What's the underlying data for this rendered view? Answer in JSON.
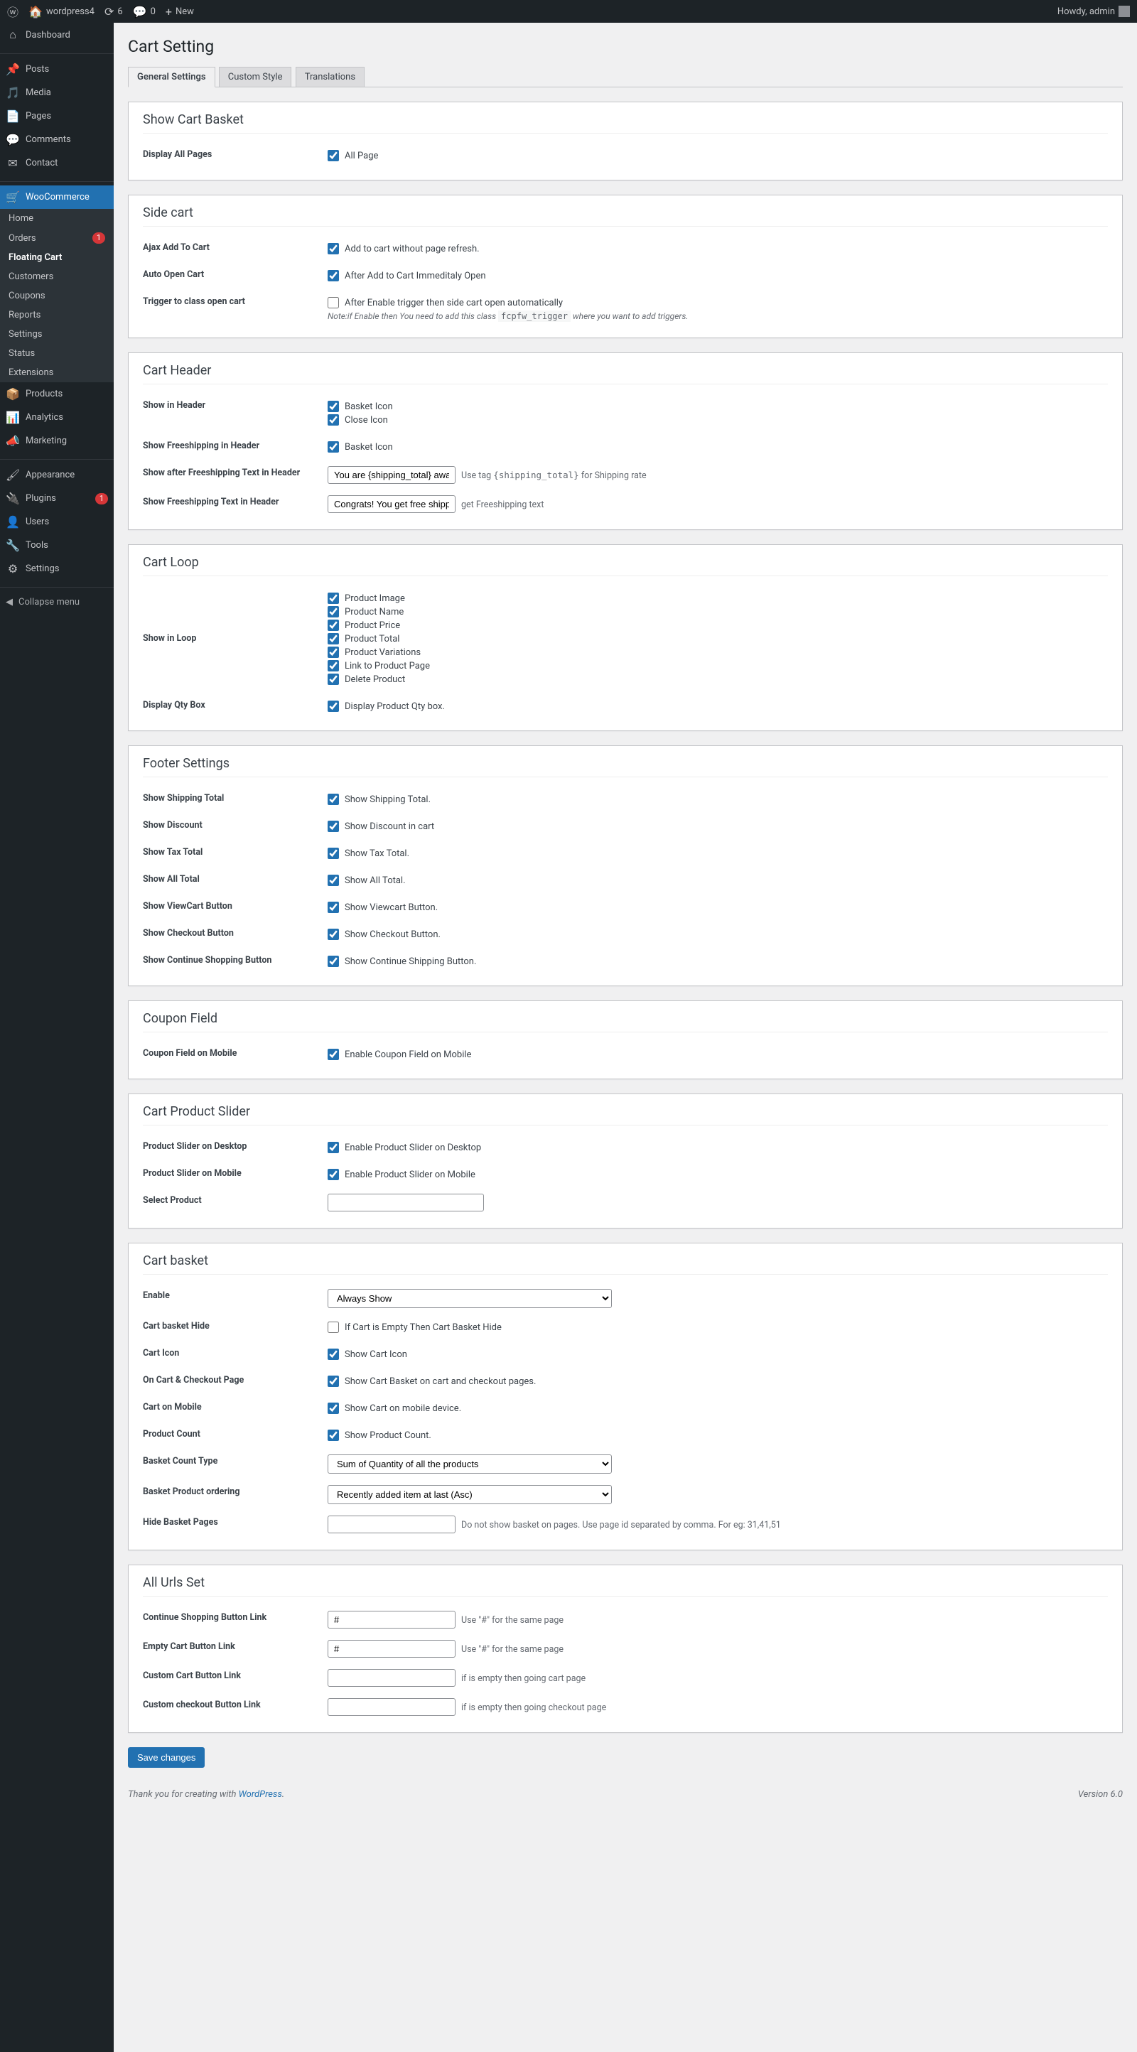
{
  "adminbar": {
    "site": "wordpress4",
    "updates": "6",
    "comments": "0",
    "new": "New",
    "howdy": "Howdy, admin"
  },
  "sidebar": {
    "dashboard": "Dashboard",
    "posts": "Posts",
    "media": "Media",
    "pages": "Pages",
    "comments": "Comments",
    "contact": "Contact",
    "woo": "WooCommerce",
    "sub_home": "Home",
    "sub_orders": "Orders",
    "orders_badge": "1",
    "sub_fc": "Floating Cart",
    "sub_customers": "Customers",
    "sub_coupons": "Coupons",
    "sub_reports": "Reports",
    "sub_settings": "Settings",
    "sub_status": "Status",
    "sub_ext": "Extensions",
    "products": "Products",
    "analytics": "Analytics",
    "marketing": "Marketing",
    "appearance": "Appearance",
    "plugins": "Plugins",
    "plugins_badge": "1",
    "users": "Users",
    "tools": "Tools",
    "settings": "Settings",
    "collapse": "Collapse menu"
  },
  "page": {
    "title": "Cart Setting",
    "tab_general": "General Settings",
    "tab_style": "Custom Style",
    "tab_trans": "Translations"
  },
  "s1": {
    "h": "Show Cart Basket",
    "l1": "Display All Pages",
    "c1": "All Page"
  },
  "s2": {
    "h": "Side cart",
    "l1": "Ajax Add To Cart",
    "c1": "Add to cart without page refresh.",
    "l2": "Auto Open Cart",
    "c2": "After Add to Cart Immeditaly Open",
    "l3": "Trigger to class open cart",
    "c3": "After Enable trigger then side cart open automatically",
    "note_a": "Note:if Enable then You need to add this class ",
    "note_code": "fcpfw_trigger",
    "note_b": " where you want to add triggers."
  },
  "s3": {
    "h": "Cart Header",
    "l1": "Show in Header",
    "c1a": "Basket Icon",
    "c1b": "Close Icon",
    "l2": "Show Freeshipping in Header",
    "c2": "Basket Icon",
    "l3": "Show after Freeshipping Text in Header",
    "v3": "You are {shipping_total} away",
    "d3a": "Use tag ",
    "d3code": "{shipping_total}",
    "d3b": " for Shipping rate",
    "l4": "Show Freeshipping Text in Header",
    "v4": "Congrats! You get free shipping",
    "d4": "get Freeshipping text"
  },
  "s4": {
    "h": "Cart Loop",
    "l1": "Show in Loop",
    "c1": "Product Image",
    "c2": "Product Name",
    "c3": "Product Price",
    "c4": "Product Total",
    "c5": "Product Variations",
    "c6": "Link to Product Page",
    "c7": "Delete Product",
    "l2": "Display Qty Box",
    "c8": "Display Product Qty box."
  },
  "s5": {
    "h": "Footer Settings",
    "l1": "Show Shipping Total",
    "c1": "Show Shipping Total.",
    "l2": "Show Discount",
    "c2": "Show Discount in cart",
    "l3": "Show Tax Total",
    "c3": "Show Tax Total.",
    "l4": "Show All Total",
    "c4": "Show All Total.",
    "l5": "Show ViewCart Button",
    "c5": "Show Viewcart Button.",
    "l6": "Show Checkout Button",
    "c6": "Show Checkout Button.",
    "l7": "Show Continue Shopping Button",
    "c7": "Show Continue Shipping Button."
  },
  "s6": {
    "h": "Coupon Field",
    "l1": "Coupon Field on Mobile",
    "c1": "Enable Coupon Field on Mobile"
  },
  "s7": {
    "h": "Cart Product Slider",
    "l1": "Product Slider on Desktop",
    "c1": "Enable Product Slider on Desktop",
    "l2": "Product Slider on Mobile",
    "c2": "Enable Product Slider on Mobile",
    "l3": "Select Product"
  },
  "s8": {
    "h": "Cart basket",
    "l1": "Enable",
    "o1": "Always Show",
    "l2": "Cart basket Hide",
    "c2": "If Cart is Empty Then Cart Basket Hide",
    "l3": "Cart Icon",
    "c3": "Show Cart Icon",
    "l4": "On Cart & Checkout Page",
    "c4": "Show Cart Basket on cart and checkout pages.",
    "l5": "Cart on Mobile",
    "c5": "Show Cart on mobile device.",
    "l6": "Product Count",
    "c6": "Show Product Count.",
    "l7": "Basket Count Type",
    "o7": "Sum of Quantity of all the products",
    "l8": "Basket Product ordering",
    "o8": "Recently added item at last (Asc)",
    "l9": "Hide Basket Pages",
    "d9": "Do not show basket on pages. Use page id separated by comma. For eg: 31,41,51"
  },
  "s9": {
    "h": "All Urls Set",
    "l1": "Continue Shopping Button Link",
    "v1": "#",
    "d1": "Use \"#\" for the same page",
    "l2": "Empty Cart Button Link",
    "v2": "#",
    "d2": "Use \"#\" for the same page",
    "l3": "Custom Cart Button Link",
    "d3": "if is empty then going cart page",
    "l4": "Custom checkout Button Link",
    "d4": "if is empty then going checkout page"
  },
  "save": "Save changes",
  "footer": {
    "thanks": "Thank you for creating with ",
    "wp": "WordPress",
    "ver": "Version 6.0"
  }
}
